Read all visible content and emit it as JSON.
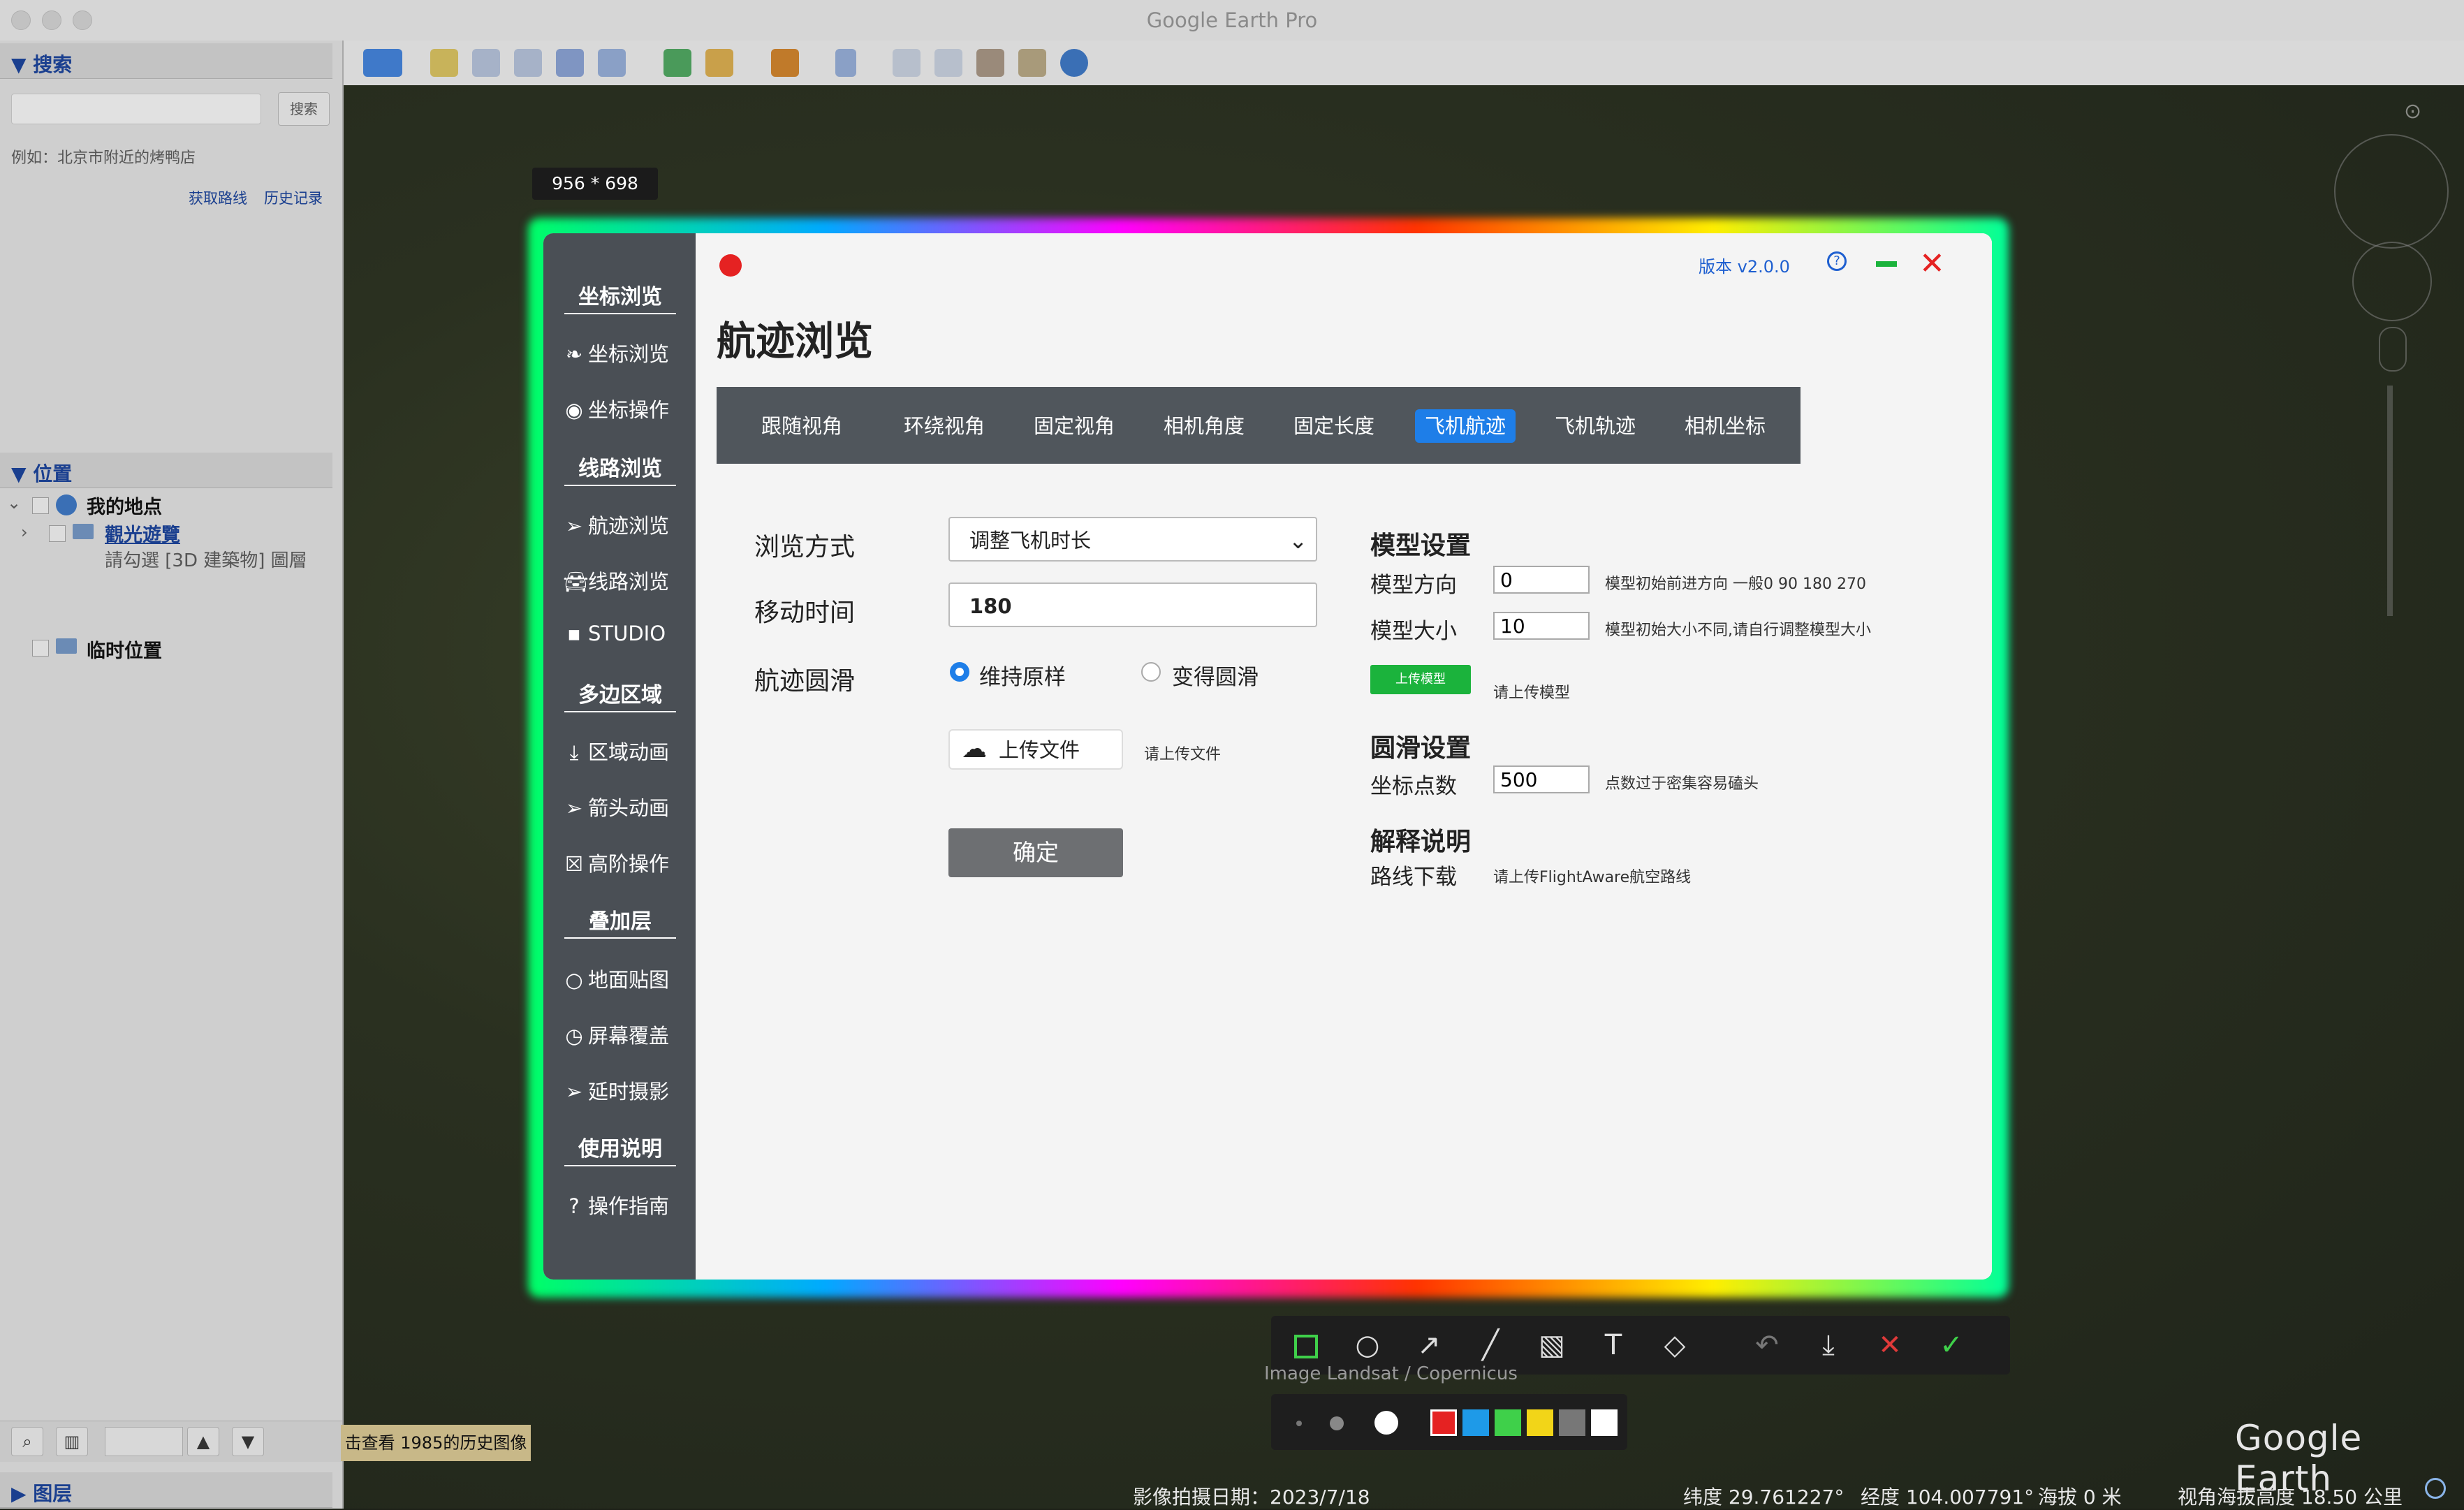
{
  "window": {
    "title": "Google Earth Pro"
  },
  "search_panel": {
    "header": "▼ 搜索",
    "search_button": "搜索",
    "example_text": "例如：北京市附近的烤鸭店",
    "get_directions": "获取路线",
    "history": "历史记录"
  },
  "places_panel": {
    "header": "▼ 位置",
    "my_places": "我的地点",
    "sightseeing": "觀光遊覽",
    "sightseeing_note": "請勾選 [3D 建築物] 圖層",
    "temporary": "临时位置"
  },
  "layers_panel": {
    "header": "▶ 图层"
  },
  "size_badge": "956 * 698",
  "dialog": {
    "version": "版本 v2.0.0",
    "title": "航迹浏览",
    "nav": {
      "h1": "坐标浏览",
      "i1": "坐标浏览",
      "i2": "坐标操作",
      "h2": "线路浏览",
      "i3": "航迹浏览",
      "i4": "线路浏览",
      "i5": "STUDIO",
      "h3": "多边区域",
      "i6": "区域动画",
      "i7": "箭头动画",
      "i8": "高阶操作",
      "h4": "叠加层",
      "i9": "地面贴图",
      "i10": "屏幕覆盖",
      "i11": "延时摄影",
      "h5": "使用说明",
      "i12": "操作指南"
    },
    "tabs": [
      "跟随视角",
      "环绕视角",
      "固定视角",
      "相机角度",
      "固定长度",
      "飞机航迹",
      "飞机轨迹",
      "相机坐标"
    ],
    "form": {
      "browse_mode_label": "浏览方式",
      "browse_mode_value": "调整飞机时长",
      "move_time_label": "移动时间",
      "move_time_value": "180",
      "smooth_label": "航迹圆滑",
      "radio_keep": "维持原样",
      "radio_smooth": "变得圆滑",
      "upload_button": "上传文件",
      "upload_hint": "请上传文件",
      "confirm_button": "确定"
    },
    "model_settings": {
      "title": "模型设置",
      "direction_label": "模型方向",
      "direction_value": "0",
      "direction_note": "模型初始前进方向 一般0 90 180 270",
      "size_label": "模型大小",
      "size_value": "10",
      "size_note": "模型初始大小不同,请自行调整模型大小",
      "upload_model_button": "上传模型",
      "upload_model_hint": "请上传模型"
    },
    "smooth_settings": {
      "title": "圆滑设置",
      "points_label": "坐标点数",
      "points_value": "500",
      "points_note": "点数过于密集容易磕头"
    },
    "explain": {
      "title": "解释说明",
      "route_label": "路线下载",
      "route_note": "请上传FlightAware航空路线"
    }
  },
  "history_button": "击查看 1985的历史图像",
  "attribution": "Image Landsat / Copernicus",
  "status": {
    "date": "影像拍摄日期：2023/7/18",
    "lat": "纬度 29.761227°",
    "lon": "经度 104.007791°",
    "alt": "海拔   0 米",
    "eye": "视角海拔高度 18.50 公里"
  },
  "logo": "Google Earth",
  "colors": {
    "accent": "#1e7ee8",
    "close_red": "#e52222",
    "minimize_green": "#1bb33c",
    "record_red": "#e52222"
  }
}
